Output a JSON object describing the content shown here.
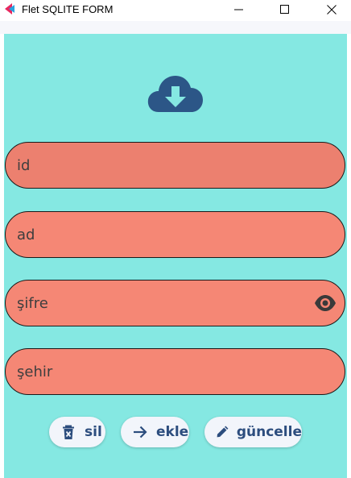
{
  "window": {
    "title": "Flet SQLITE FORM",
    "controls": [
      "minimize-icon",
      "maximize-icon",
      "close-icon"
    ]
  },
  "form": {
    "header_icon": "cloud-download-icon",
    "fields": {
      "id": {
        "placeholder": "id",
        "value": ""
      },
      "ad": {
        "placeholder": "ad",
        "value": ""
      },
      "sifre": {
        "placeholder": "şifre",
        "value": "",
        "trailing_icon": "eye-icon"
      },
      "sehir": {
        "placeholder": "şehir",
        "value": ""
      }
    },
    "buttons": {
      "sil": {
        "label": "sil",
        "icon": "delete-icon"
      },
      "ekle": {
        "label": "ekle",
        "icon": "arrow-right-icon"
      },
      "guncelle": {
        "label": "güncelle",
        "icon": "edit-pencil-icon"
      }
    }
  },
  "colors": {
    "background": "#85e8e2",
    "field_fill": "#f58775",
    "field_fill_focused": "#ec806f",
    "accent": "#2c4d7e",
    "button_fill": "#f2f5fb"
  }
}
